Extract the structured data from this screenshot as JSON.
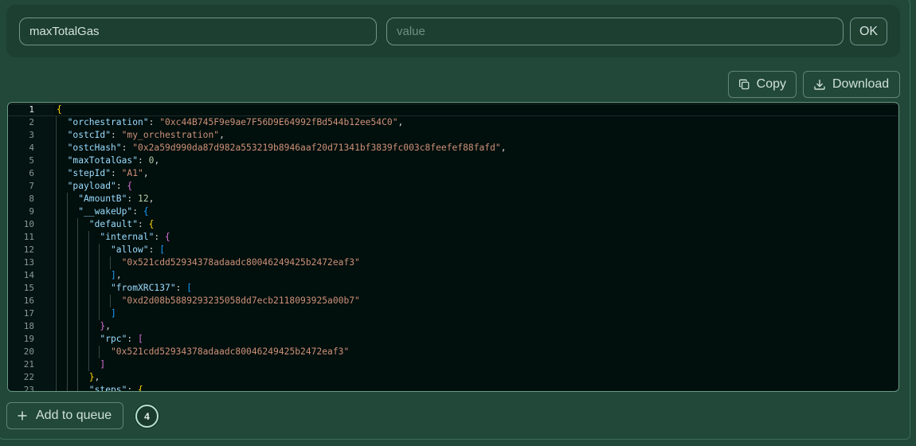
{
  "kv_form": {
    "key_value": "maxTotalGas",
    "value_placeholder": "value",
    "ok_label": "OK"
  },
  "toolbar": {
    "copy_label": "Copy",
    "download_label": "Download",
    "copy_icon": "copy-icon",
    "download_icon": "download-icon"
  },
  "editor": {
    "active_line": 1,
    "lines": [
      {
        "n": "1",
        "ind": 0,
        "t": [
          [
            "b1",
            "{"
          ]
        ]
      },
      {
        "n": "2",
        "ind": 1,
        "t": [
          [
            "k",
            "\"orchestration\""
          ],
          [
            "p",
            ": "
          ],
          [
            "s",
            "\"0xc44B745F9e9ae7F56D9E64992fBd544b12ee54C0\""
          ],
          [
            "p",
            ","
          ]
        ]
      },
      {
        "n": "3",
        "ind": 1,
        "t": [
          [
            "k",
            "\"ostcId\""
          ],
          [
            "p",
            ": "
          ],
          [
            "s",
            "\"my_orchestration\""
          ],
          [
            "p",
            ","
          ]
        ]
      },
      {
        "n": "4",
        "ind": 1,
        "t": [
          [
            "k",
            "\"ostcHash\""
          ],
          [
            "p",
            ": "
          ],
          [
            "s",
            "\"0x2a59d990da87d982a553219b8946aaf20d71341bf3839fc003c8feefef88fafd\""
          ],
          [
            "p",
            ","
          ]
        ]
      },
      {
        "n": "5",
        "ind": 1,
        "t": [
          [
            "k",
            "\"maxTotalGas\""
          ],
          [
            "p",
            ": "
          ],
          [
            "n",
            "0"
          ],
          [
            "p",
            ","
          ]
        ]
      },
      {
        "n": "6",
        "ind": 1,
        "t": [
          [
            "k",
            "\"stepId\""
          ],
          [
            "p",
            ": "
          ],
          [
            "s",
            "\"A1\""
          ],
          [
            "p",
            ","
          ]
        ]
      },
      {
        "n": "7",
        "ind": 1,
        "t": [
          [
            "k",
            "\"payload\""
          ],
          [
            "p",
            ": "
          ],
          [
            "b2",
            "{"
          ]
        ]
      },
      {
        "n": "8",
        "ind": 2,
        "t": [
          [
            "k",
            "\"AmountB\""
          ],
          [
            "p",
            ": "
          ],
          [
            "n",
            "12"
          ],
          [
            "p",
            ","
          ]
        ]
      },
      {
        "n": "9",
        "ind": 2,
        "t": [
          [
            "k",
            "\"__wakeUp\""
          ],
          [
            "p",
            ": "
          ],
          [
            "b3",
            "{"
          ]
        ]
      },
      {
        "n": "10",
        "ind": 3,
        "t": [
          [
            "k",
            "\"default\""
          ],
          [
            "p",
            ": "
          ],
          [
            "b1",
            "{"
          ]
        ]
      },
      {
        "n": "11",
        "ind": 4,
        "t": [
          [
            "k",
            "\"internal\""
          ],
          [
            "p",
            ": "
          ],
          [
            "b2",
            "{"
          ]
        ]
      },
      {
        "n": "12",
        "ind": 5,
        "t": [
          [
            "k",
            "\"allow\""
          ],
          [
            "p",
            ": "
          ],
          [
            "b3",
            "["
          ]
        ]
      },
      {
        "n": "13",
        "ind": 6,
        "t": [
          [
            "s",
            "\"0x521cdd52934378adaadc80046249425b2472eaf3\""
          ]
        ]
      },
      {
        "n": "14",
        "ind": 5,
        "t": [
          [
            "b3",
            "]"
          ],
          [
            "p",
            ","
          ]
        ]
      },
      {
        "n": "15",
        "ind": 5,
        "t": [
          [
            "k",
            "\"fromXRC137\""
          ],
          [
            "p",
            ": "
          ],
          [
            "b3",
            "["
          ]
        ]
      },
      {
        "n": "16",
        "ind": 6,
        "t": [
          [
            "s",
            "\"0xd2d08b5889293235058dd7ecb2118093925a00b7\""
          ]
        ]
      },
      {
        "n": "17",
        "ind": 5,
        "t": [
          [
            "b3",
            "]"
          ]
        ]
      },
      {
        "n": "18",
        "ind": 4,
        "t": [
          [
            "b2",
            "}"
          ],
          [
            "p",
            ","
          ]
        ]
      },
      {
        "n": "19",
        "ind": 4,
        "t": [
          [
            "k",
            "\"rpc\""
          ],
          [
            "p",
            ": "
          ],
          [
            "b2",
            "["
          ]
        ]
      },
      {
        "n": "20",
        "ind": 5,
        "t": [
          [
            "s",
            "\"0x521cdd52934378adaadc80046249425b2472eaf3\""
          ]
        ]
      },
      {
        "n": "21",
        "ind": 4,
        "t": [
          [
            "b2",
            "]"
          ]
        ]
      },
      {
        "n": "22",
        "ind": 3,
        "t": [
          [
            "b1",
            "}"
          ],
          [
            "p",
            ","
          ]
        ]
      },
      {
        "n": "23",
        "ind": 3,
        "t": [
          [
            "k",
            "\"steps\""
          ],
          [
            "p",
            ": "
          ],
          [
            "b1",
            "{"
          ]
        ]
      }
    ]
  },
  "queue": {
    "add_label": "Add to queue",
    "add_icon": "plus-icon",
    "count": "4"
  }
}
